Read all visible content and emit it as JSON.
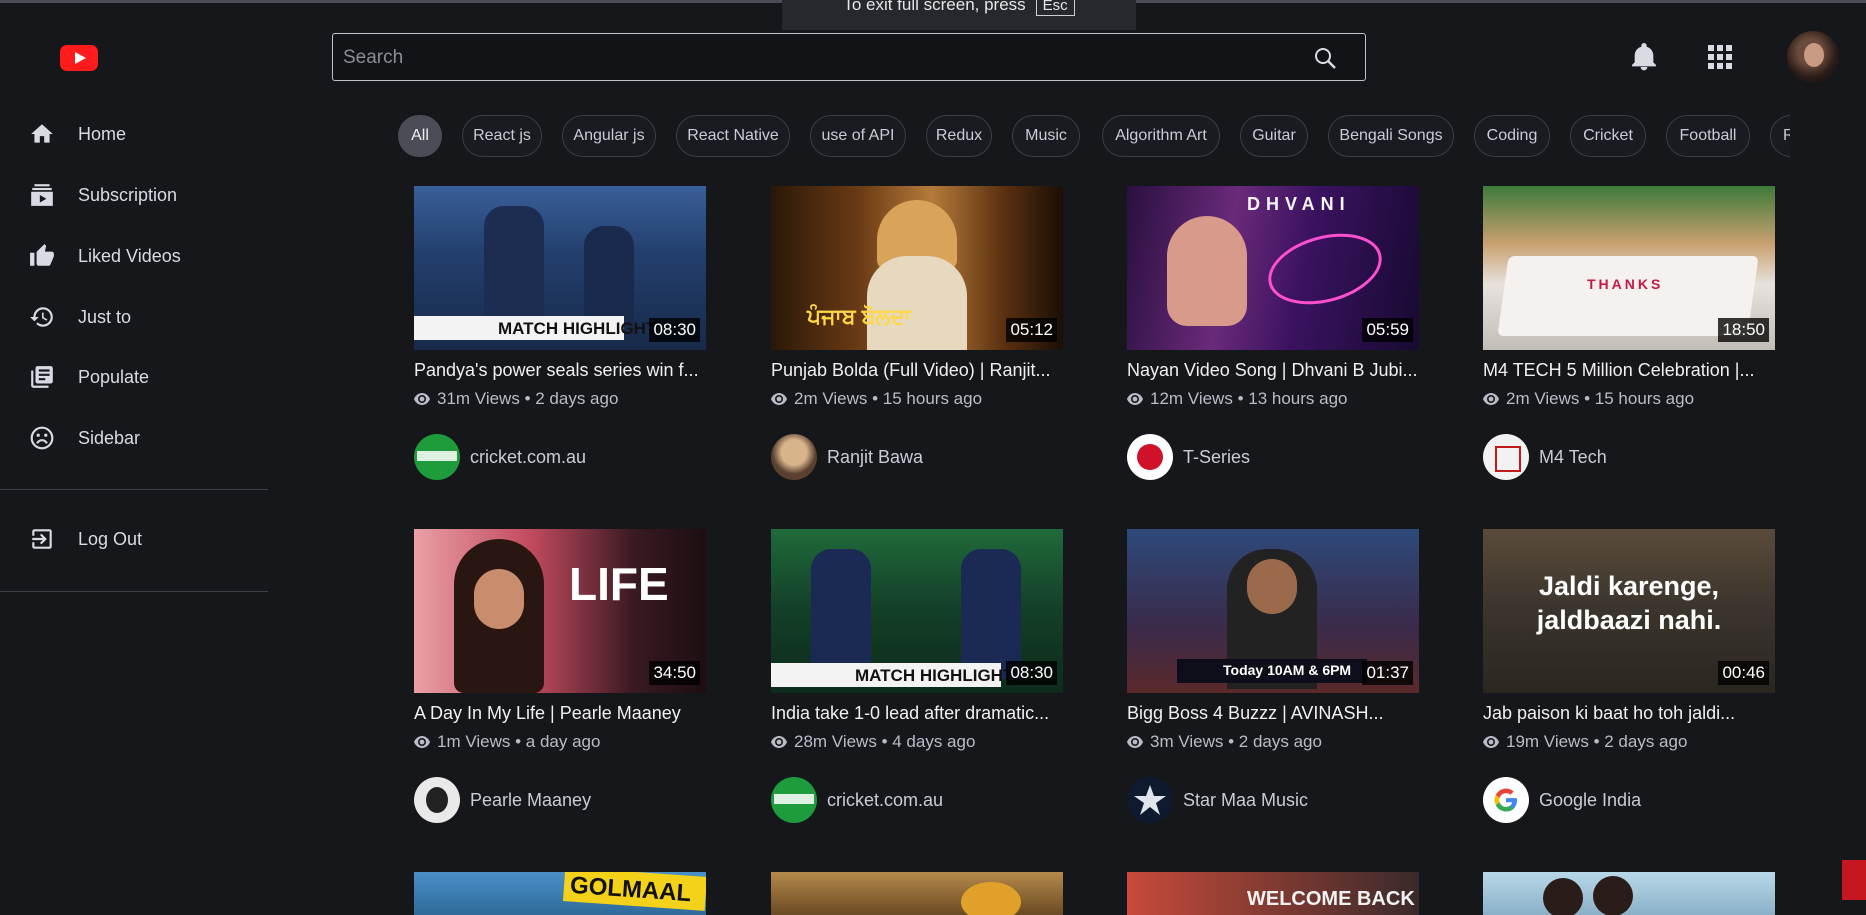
{
  "fullscreen_notice": {
    "text": "To exit full screen, press",
    "key": "Esc"
  },
  "search": {
    "placeholder": "Search"
  },
  "sidebar": {
    "items": [
      {
        "label": "Home",
        "icon": "home-icon"
      },
      {
        "label": "Subscription",
        "icon": "subscription-icon"
      },
      {
        "label": "Liked Videos",
        "icon": "thumbs-up-icon"
      },
      {
        "label": "Just to",
        "icon": "history-icon"
      },
      {
        "label": "Populate",
        "icon": "playlist-icon"
      },
      {
        "label": "Sidebar",
        "icon": "sad-face-icon"
      }
    ],
    "logout": {
      "label": "Log Out",
      "icon": "logout-icon"
    }
  },
  "chips": [
    "All",
    "React js",
    "Angular js",
    "React Native",
    "use of API",
    "Redux",
    "Music",
    "Algorithm Art",
    "Guitar",
    "Bengali Songs",
    "Coding",
    "Cricket",
    "Football",
    "Re"
  ],
  "videos": [
    {
      "title": "Pandya's power seals series win f...",
      "views": "31m Views",
      "age": "2 days ago",
      "duration": "08:30",
      "channel": "cricket.com.au",
      "thumb_text": "MATCH HIGHLIGHT"
    },
    {
      "title": "Punjab Bolda (Full Video) | Ranjit...",
      "views": "2m Views",
      "age": "15 hours ago",
      "duration": "05:12",
      "channel": "Ranjit Bawa",
      "thumb_text": "ਪੰਜਾਬ ਬੋਲਦਾ"
    },
    {
      "title": "Nayan Video Song | Dhvani B Jubi...",
      "views": "12m Views",
      "age": "13 hours ago",
      "duration": "05:59",
      "channel": "T-Series",
      "thumb_text": "DHVANI"
    },
    {
      "title": "M4 TECH 5 Million Celebration |...",
      "views": "2m Views",
      "age": "15 hours ago",
      "duration": "18:50",
      "channel": "M4 Tech",
      "thumb_text": "THANKS"
    },
    {
      "title": "A Day In My Life | Pearle Maaney",
      "views": "1m Views",
      "age": "a day ago",
      "duration": "34:50",
      "channel": "Pearle Maaney",
      "thumb_text": "LIFE"
    },
    {
      "title": "India take 1-0 lead after dramatic...",
      "views": "28m Views",
      "age": "4 days ago",
      "duration": "08:30",
      "channel": "cricket.com.au",
      "thumb_text": "MATCH HIGHLIGHT"
    },
    {
      "title": "Bigg Boss 4 Buzzz | AVINASH...",
      "views": "3m Views",
      "age": "2 days ago",
      "duration": "01:37",
      "channel": "Star Maa Music",
      "thumb_text": "Today 10AM & 6PM"
    },
    {
      "title": "Jab paison ki baat ho toh jaldi...",
      "views": "19m Views",
      "age": "2 days ago",
      "duration": "00:46",
      "channel": "Google India",
      "thumb_text": "Jaldi karenge, jaldbaazi nahi."
    }
  ],
  "partial_row": [
    {
      "thumb_text": "GOLMAAL"
    },
    {
      "thumb_text": ""
    },
    {
      "thumb_text": "WELCOME BACK"
    },
    {
      "thumb_text": ""
    }
  ],
  "colors": {
    "background": "#16171b",
    "logo_red": "#ff1b1b",
    "chip_active": "#4a4d55",
    "border": "#3b3e45"
  }
}
